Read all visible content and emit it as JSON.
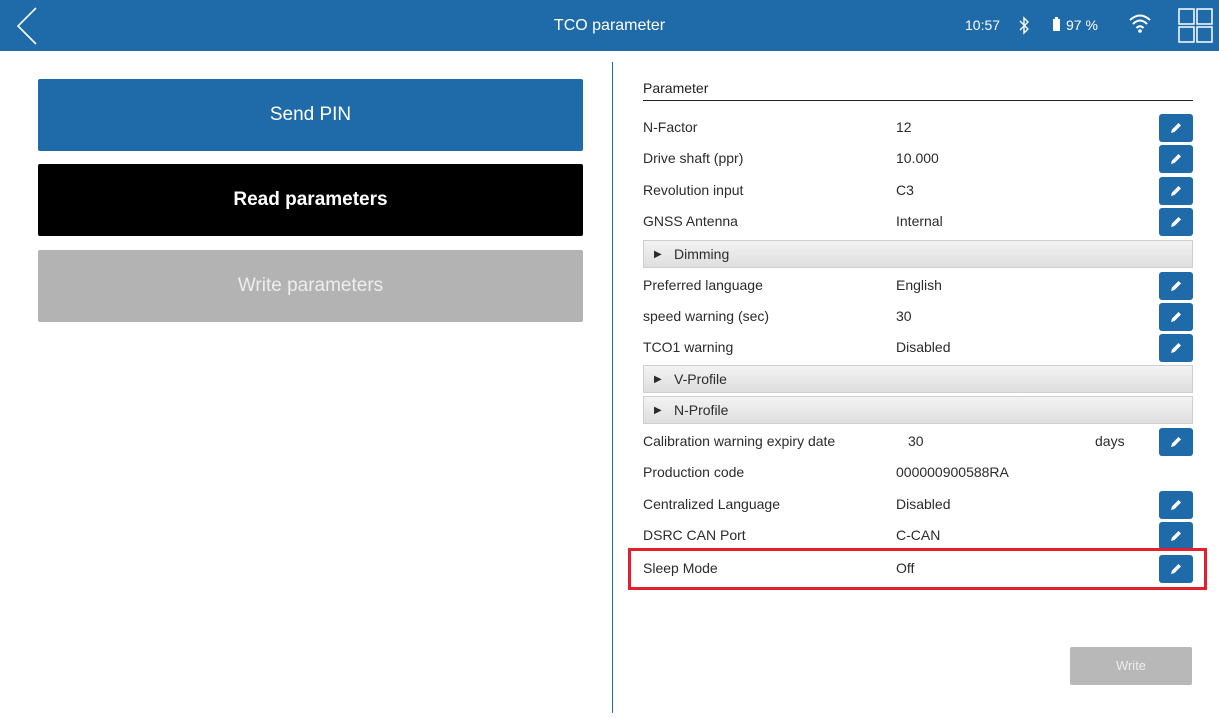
{
  "header": {
    "title": "TCO parameter",
    "time": "10:57",
    "battery": "97 %"
  },
  "left": {
    "send_pin": "Send PIN",
    "read_parameters": "Read parameters",
    "write_parameters": "Write parameters"
  },
  "params": {
    "section_title": "Parameter",
    "rows": [
      {
        "label": "N-Factor",
        "value": "12"
      },
      {
        "label": "Drive shaft (ppr)",
        "value": "10.000"
      },
      {
        "label": "Revolution input",
        "value": "C3"
      },
      {
        "label": "GNSS Antenna",
        "value": "Internal"
      },
      {
        "label": "Preferred language",
        "value": "English"
      },
      {
        "label": "speed warning (sec)",
        "value": "30"
      },
      {
        "label": "TCO1 warning",
        "value": "Disabled"
      },
      {
        "label": "Calibration warning expiry date",
        "value": "30",
        "unit": "days"
      },
      {
        "label": "Production code",
        "value": "000000900588RA"
      },
      {
        "label": "Centralized Language",
        "value": "Disabled"
      },
      {
        "label": "DSRC CAN Port",
        "value": "C-CAN"
      },
      {
        "label": "Sleep Mode",
        "value": "Off"
      }
    ],
    "groups": [
      "Dimming",
      "V-Profile",
      "N-Profile"
    ]
  },
  "footer": {
    "write_label": "Write"
  },
  "colors": {
    "brand": "#1f6aa8",
    "highlight": "#e3202b"
  },
  "icons": {
    "edit": "pencil-icon",
    "back": "chevron-left-icon",
    "grid": "grid-icon",
    "bluetooth": "bluetooth-icon",
    "battery": "battery-icon",
    "wifi": "wifi-icon"
  }
}
